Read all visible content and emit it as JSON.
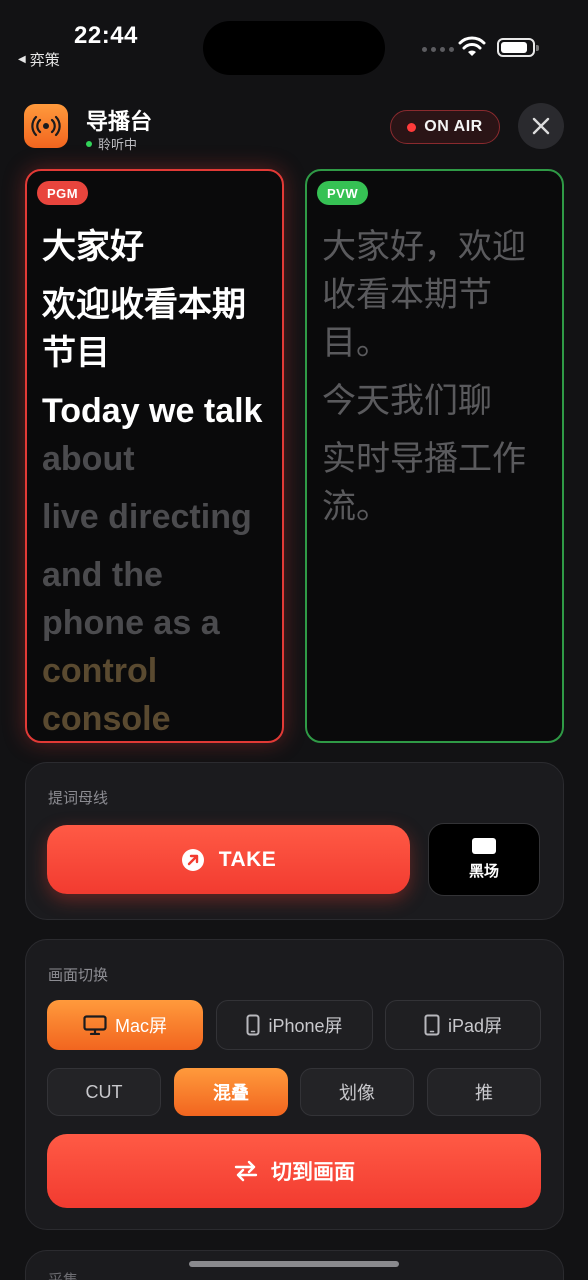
{
  "status_bar": {
    "time": "22:44",
    "back_app": "弈策"
  },
  "header": {
    "title": "导播台",
    "status": "聆听中",
    "on_air": "ON AIR"
  },
  "pgm": {
    "tag": "PGM",
    "lines": [
      {
        "parts": [
          {
            "text": "大家好",
            "style": "live"
          }
        ]
      },
      {
        "parts": [
          {
            "text": "欢迎收看本期节目",
            "style": "live"
          }
        ]
      },
      {
        "parts": [
          {
            "text": "Today we talk",
            "style": "live"
          },
          {
            "text": " about",
            "style": "dim"
          }
        ]
      },
      {
        "parts": [
          {
            "text": "live directing",
            "style": "dim"
          }
        ]
      },
      {
        "parts": [
          {
            "text": "and the phone as a",
            "style": "dim"
          },
          {
            "text": " control console",
            "style": "gold"
          }
        ]
      }
    ]
  },
  "pvw": {
    "tag": "PVW",
    "lines": [
      "大家好，欢迎收看本期节目。",
      "今天我们聊",
      "实时导播工作流。"
    ]
  },
  "prompt_bus": {
    "label": "提词母线",
    "take": "TAKE",
    "black": "黑场"
  },
  "switcher": {
    "label": "画面切换",
    "sources": [
      {
        "label": "Mac屏",
        "icon": "monitor-icon",
        "active": true
      },
      {
        "label": "iPhone屏",
        "icon": "phone-icon",
        "active": false
      },
      {
        "label": "iPad屏",
        "icon": "tablet-icon",
        "active": false
      }
    ],
    "transitions": [
      {
        "label": "CUT",
        "active": false
      },
      {
        "label": "混叠",
        "active": true
      },
      {
        "label": "划像",
        "active": false
      },
      {
        "label": "推",
        "active": false
      }
    ],
    "cut_to": "切到画面"
  },
  "capture": {
    "label": "采集"
  },
  "colors": {
    "pgm": "#e23a36",
    "pvw": "#2f9a46",
    "accent": "#f2651f",
    "take": "#f23b30"
  }
}
